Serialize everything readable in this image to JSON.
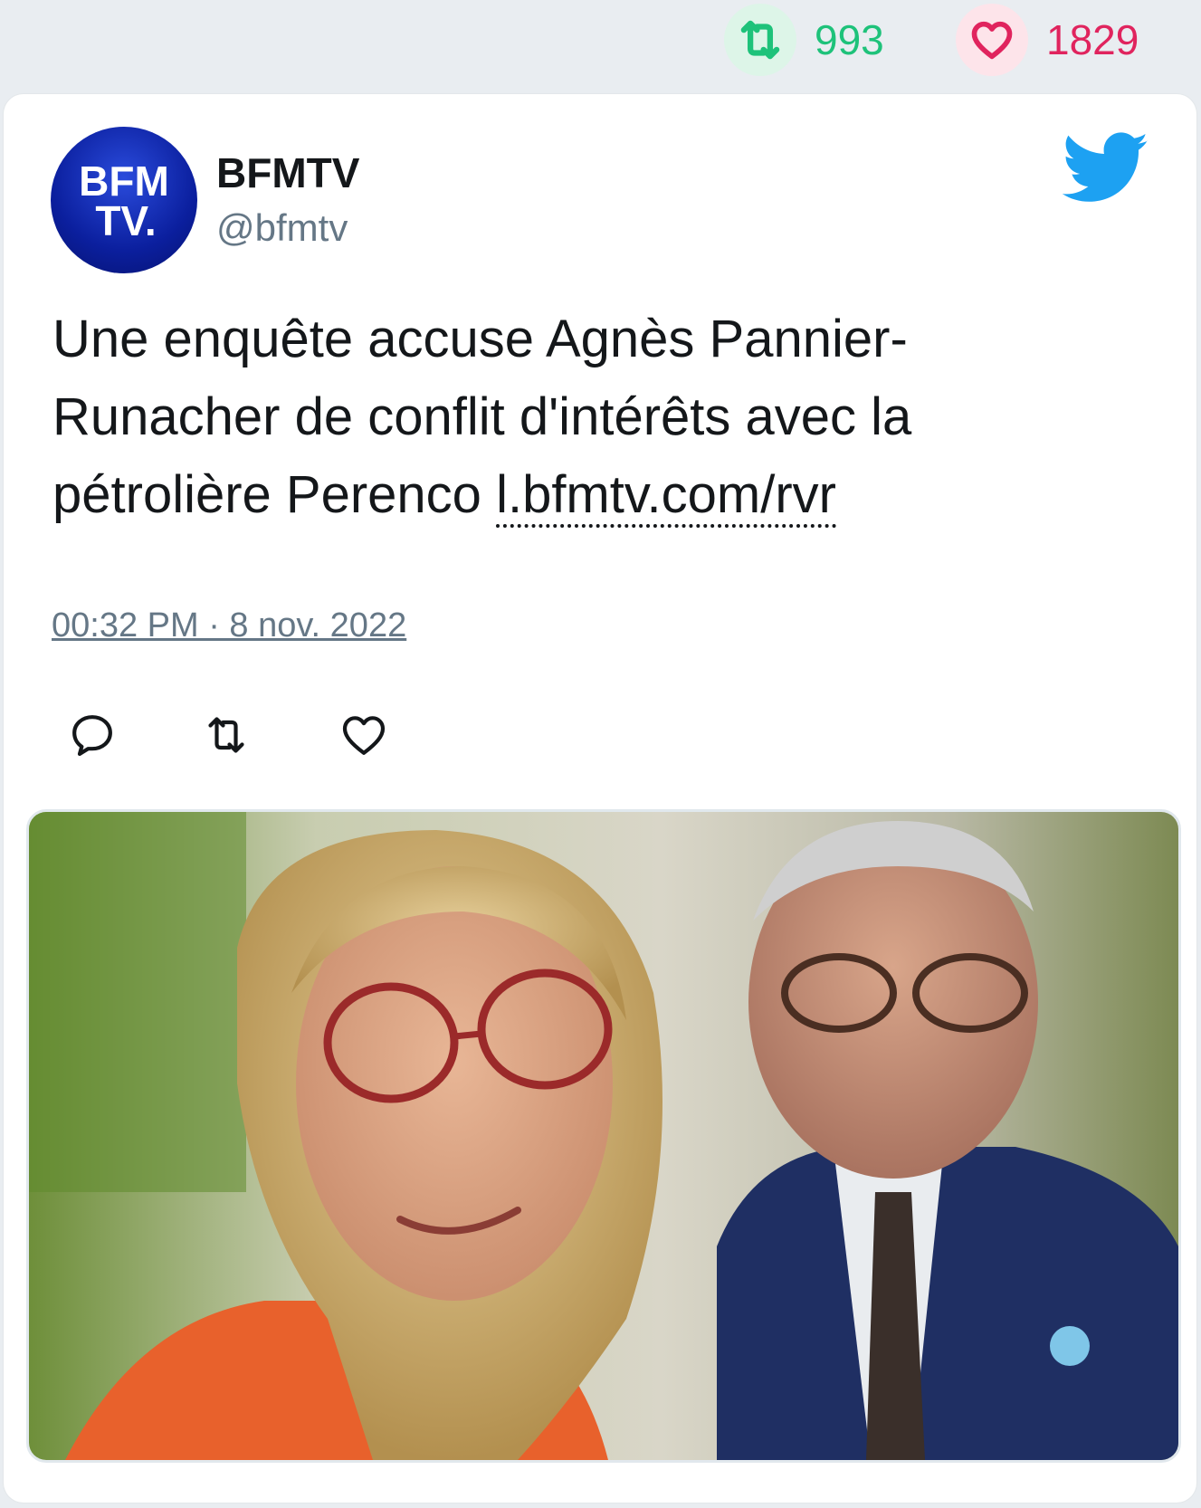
{
  "header_stats": {
    "retweet_count": "993",
    "like_count": "1829"
  },
  "tweet": {
    "author_name": "BFMTV",
    "author_handle": "@bfmtv",
    "avatar_text_line1": "BFM",
    "avatar_text_line2": "TV.",
    "text": "Une enquête accuse Agnès Pannier-Runacher de conflit d'intérêts avec la pétrolière Perenco ",
    "link": "l.bfmtv.com/rvr",
    "timestamp": "00:32 PM · 8 nov. 2022"
  },
  "icons": {
    "retweet": "retweet-icon",
    "like": "heart-icon",
    "reply": "reply-icon",
    "brand": "twitter-bird-icon"
  },
  "colors": {
    "retweet_green": "#1ec27a",
    "like_red": "#e0245e",
    "twitter_blue": "#1da1f2",
    "avatar_blue": "#0b1f9e"
  }
}
